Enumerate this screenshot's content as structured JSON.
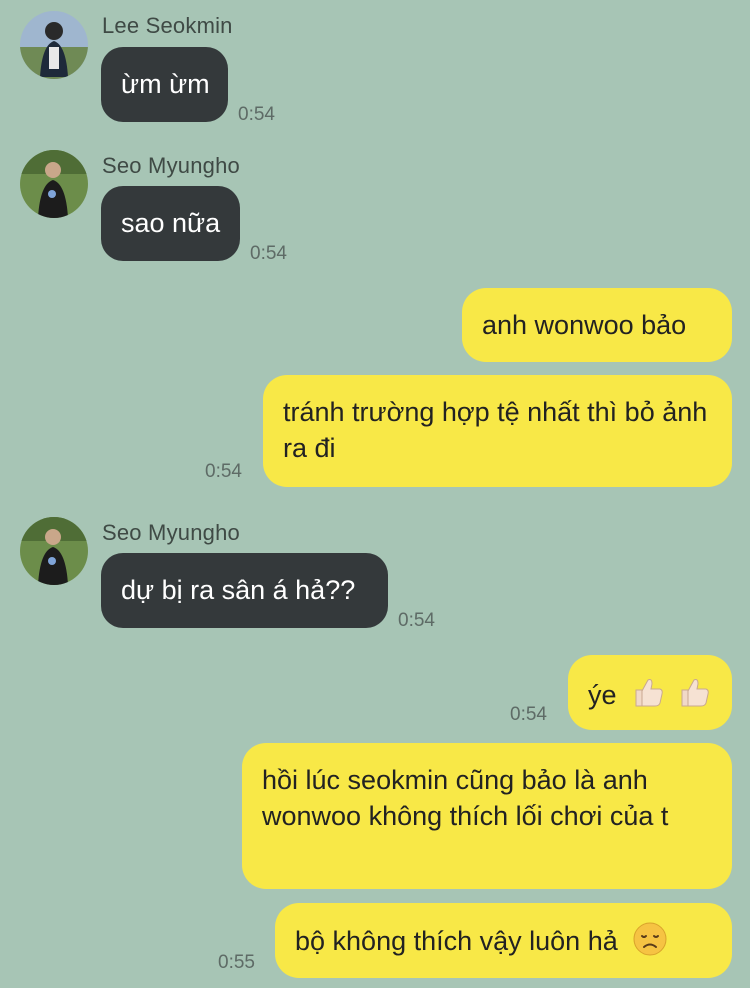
{
  "messages": [
    {
      "sender": "Lee Seokmin",
      "text": "ừm ừm",
      "time": "0:54"
    },
    {
      "sender": "Seo Myungho",
      "text": "sao nữa",
      "time": "0:54"
    },
    {
      "text": "anh wonwoo bảo"
    },
    {
      "text": "tránh trường hợp tệ nhất thì bỏ ảnh ra đi",
      "time": "0:54"
    },
    {
      "sender": "Seo Myungho",
      "text": "dự bị ra sân á hả??",
      "time": "0:54"
    },
    {
      "text": "ýe",
      "emoji": "thumbs-up-icon ×2",
      "time": "0:54"
    },
    {
      "text": "hồi lúc seokmin cũng bảo là anh wonwoo không thích lối chơi của t"
    },
    {
      "text": "bộ không thích vậy luôn hả",
      "emoji": "disappointed-face-icon",
      "time": "0:55"
    }
  ],
  "colors": {
    "background": "#a7c5b5",
    "incoming_bubble": "#34393b",
    "outgoing_bubble": "#f8e847"
  }
}
